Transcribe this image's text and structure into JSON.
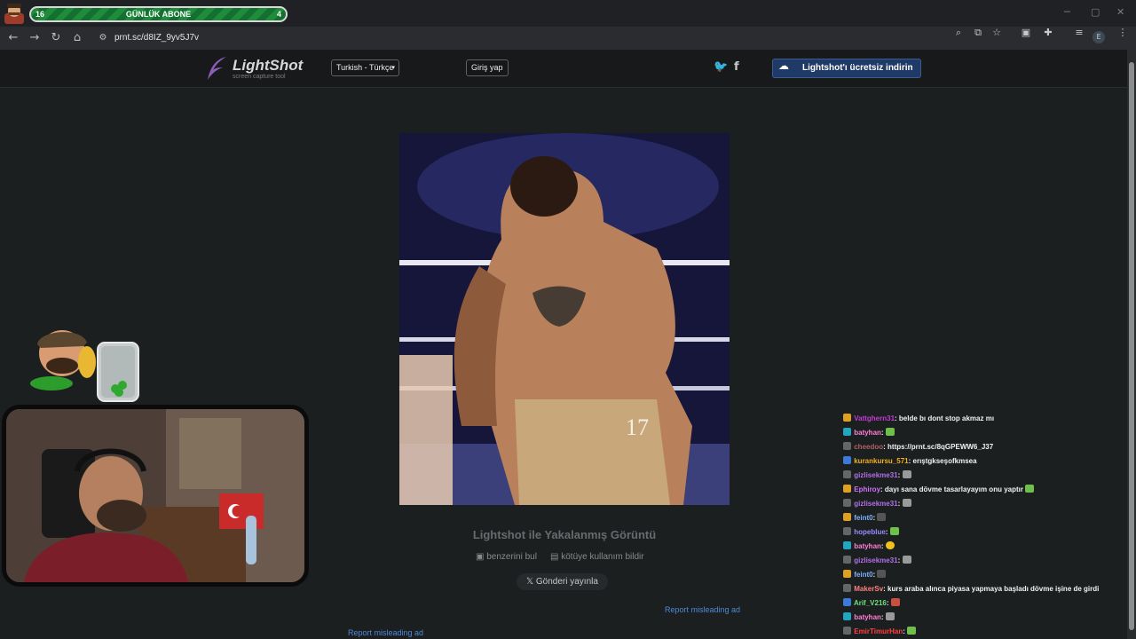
{
  "stream_overlay": {
    "sub_goal": {
      "current": "16",
      "label": "GÜNLÜK ABONE",
      "target": "4"
    }
  },
  "browser": {
    "url": "prnt.sc/d8IZ_9yv5J7v",
    "profile_initial": "E"
  },
  "lightshot": {
    "logo": "LightShot",
    "logo_sub": "screen capture tool",
    "language_select": "Turkish - Türkçe",
    "login_button": "Giriş yap",
    "download_button": "Lightshot'ı ücretsiz indirin",
    "caption": "Lightshot ile Yakalanmış Görüntü",
    "find_similar": "benzerini bul",
    "report_abuse": "kötüye kullanım bildir",
    "share_button": "Gönderi yayınla",
    "report_ad_right": "Report misleading ad",
    "report_ad_left": "Report misleading ad"
  },
  "chat": {
    "messages": [
      {
        "user": "Vattghern31",
        "text": "belde bı dont stop akmaz mı",
        "color": "#c23bd2"
      },
      {
        "user": "batyhan",
        "text": "",
        "color": "#ff7fd7"
      },
      {
        "user": "cheedoo",
        "text": "https://prnt.sc/8qGPEWW6_J37",
        "color": "#b06060"
      },
      {
        "user": "kurankursu_571",
        "text": "erıştgkseşofkmsea",
        "color": "#f0b020"
      },
      {
        "user": "gizlisekme31",
        "text": "",
        "color": "#b070e8"
      },
      {
        "user": "Ephiroy",
        "text": "dayı sana dövme tasarlayayım onu yaptır",
        "color": "#d070ff"
      },
      {
        "user": "gizlisekme31",
        "text": "",
        "color": "#b070e8"
      },
      {
        "user": "feint0",
        "text": "",
        "color": "#7fb0ff"
      },
      {
        "user": "hopeblue",
        "text": "",
        "color": "#9a8cff"
      },
      {
        "user": "batyhan",
        "text": "",
        "color": "#ff7fd7"
      },
      {
        "user": "gizlisekme31",
        "text": "",
        "color": "#b070e8"
      },
      {
        "user": "feint0",
        "text": "",
        "color": "#7fb0ff"
      },
      {
        "user": "MakerSv",
        "text": "kurs araba alınca piyasa yapmaya başladı dövme işine de girdi",
        "color": "#ff8080"
      },
      {
        "user": "Arif_V216",
        "text": "",
        "color": "#6fe07f"
      },
      {
        "user": "batyhan",
        "text": "",
        "color": "#ff7fd7"
      },
      {
        "user": "EmirTimurHan",
        "text": "",
        "color": "#ff4040"
      }
    ]
  }
}
